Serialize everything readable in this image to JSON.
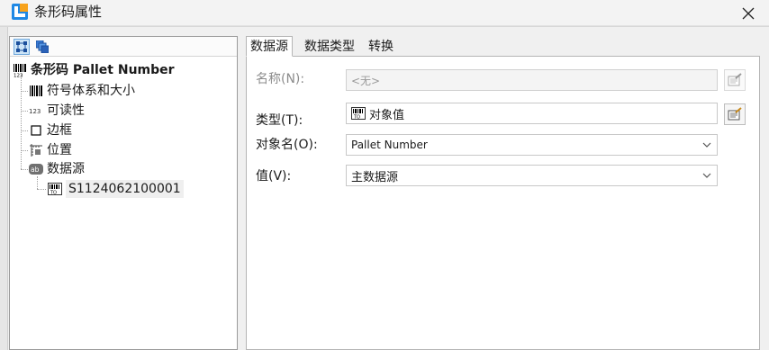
{
  "window": {
    "title": "条形码属性",
    "close_icon": "close-icon"
  },
  "tree_toolbar": {
    "buttons": [
      "tree-expand-icon",
      "tree-layers-icon"
    ]
  },
  "tree": {
    "root": "条形码 Pallet Number",
    "items": [
      {
        "label": "符号体系和大小",
        "icon": "barcode-icon"
      },
      {
        "label": "可读性",
        "icon": "readable-123-icon"
      },
      {
        "label": "边框",
        "icon": "border-icon"
      },
      {
        "label": "位置",
        "icon": "position-icon"
      },
      {
        "label": "数据源",
        "icon": "datasource-ab-icon"
      }
    ],
    "child": {
      "label": "S1124062100001",
      "icon": "object-value-icon"
    }
  },
  "tabs": [
    "数据源",
    "数据类型",
    "转换"
  ],
  "active_tab": "数据源",
  "form": {
    "name_label": "名称(N):",
    "name_value": "<无>",
    "type_label": "类型(T):",
    "type_value": "对象值",
    "object_label": "对象名(O):",
    "object_value": "Pallet Number",
    "value_label": "值(V):",
    "value_value": "主数据源"
  },
  "colors": {
    "accent": "#1e88e5",
    "selection": "#cce4f7",
    "border": "#9a9a9a"
  }
}
